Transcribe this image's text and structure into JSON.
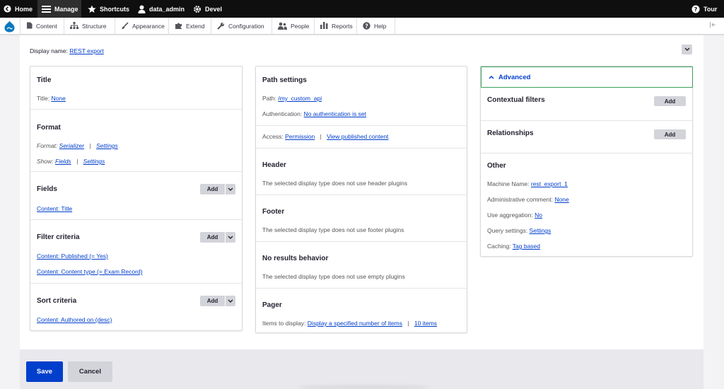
{
  "toolbar": {
    "home": "Home",
    "manage": "Manage",
    "shortcuts": "Shortcuts",
    "user": "data_admin",
    "devel": "Devel",
    "tour": "Tour"
  },
  "tray": {
    "items": [
      "Content",
      "Structure",
      "Appearance",
      "Extend",
      "Configuration",
      "People",
      "Reports",
      "Help"
    ]
  },
  "display": {
    "label": "Display name:",
    "value": "REST export"
  },
  "col1": {
    "title": {
      "heading": "Title",
      "label": "Title:",
      "value": "None"
    },
    "format": {
      "heading": "Format",
      "format_label": "Format:",
      "format_value": "Serializer",
      "format_settings": "Settings",
      "show_label": "Show:",
      "show_value": "Fields",
      "show_settings": "Settings"
    },
    "fields": {
      "heading": "Fields",
      "add": "Add",
      "items": [
        "Content: Title"
      ]
    },
    "filter": {
      "heading": "Filter criteria",
      "add": "Add",
      "items": [
        "Content: Published (= Yes)",
        "Content: Content type (= Exam Record)"
      ]
    },
    "sort": {
      "heading": "Sort criteria",
      "add": "Add",
      "items": [
        "Content: Authored on (desc)"
      ]
    }
  },
  "col2": {
    "path": {
      "heading": "Path settings",
      "path_label": "Path:",
      "path_value": "/my_custom_api",
      "auth_label": "Authentication:",
      "auth_value": "No authentication is set",
      "access_label": "Access:",
      "access_value": "Permission",
      "access_perm": "View published content"
    },
    "header": {
      "heading": "Header",
      "text": "The selected display type does not use header plugins"
    },
    "footer": {
      "heading": "Footer",
      "text": "The selected display type does not use footer plugins"
    },
    "noresults": {
      "heading": "No results behavior",
      "text": "The selected display type does not use empty plugins"
    },
    "pager": {
      "heading": "Pager",
      "label": "Items to display:",
      "value": "Display a specified number of items",
      "count": "10 items"
    }
  },
  "col3": {
    "advanced": "Advanced",
    "contextual": {
      "heading": "Contextual filters",
      "add": "Add"
    },
    "relationships": {
      "heading": "Relationships",
      "add": "Add"
    },
    "other": {
      "heading": "Other",
      "machine_label": "Machine Name:",
      "machine_value": "rest_export_1",
      "admin_label": "Administrative comment:",
      "admin_value": "None",
      "agg_label": "Use aggregation:",
      "agg_value": "No",
      "query_label": "Query settings:",
      "query_value": "Settings",
      "cache_label": "Caching:",
      "cache_value": "Tag based"
    }
  },
  "actions": {
    "save": "Save",
    "cancel": "Cancel"
  },
  "colors": {
    "primary": "#003ecc",
    "toolbar": "#0f0f0f",
    "focus": "#3b9e5a"
  }
}
